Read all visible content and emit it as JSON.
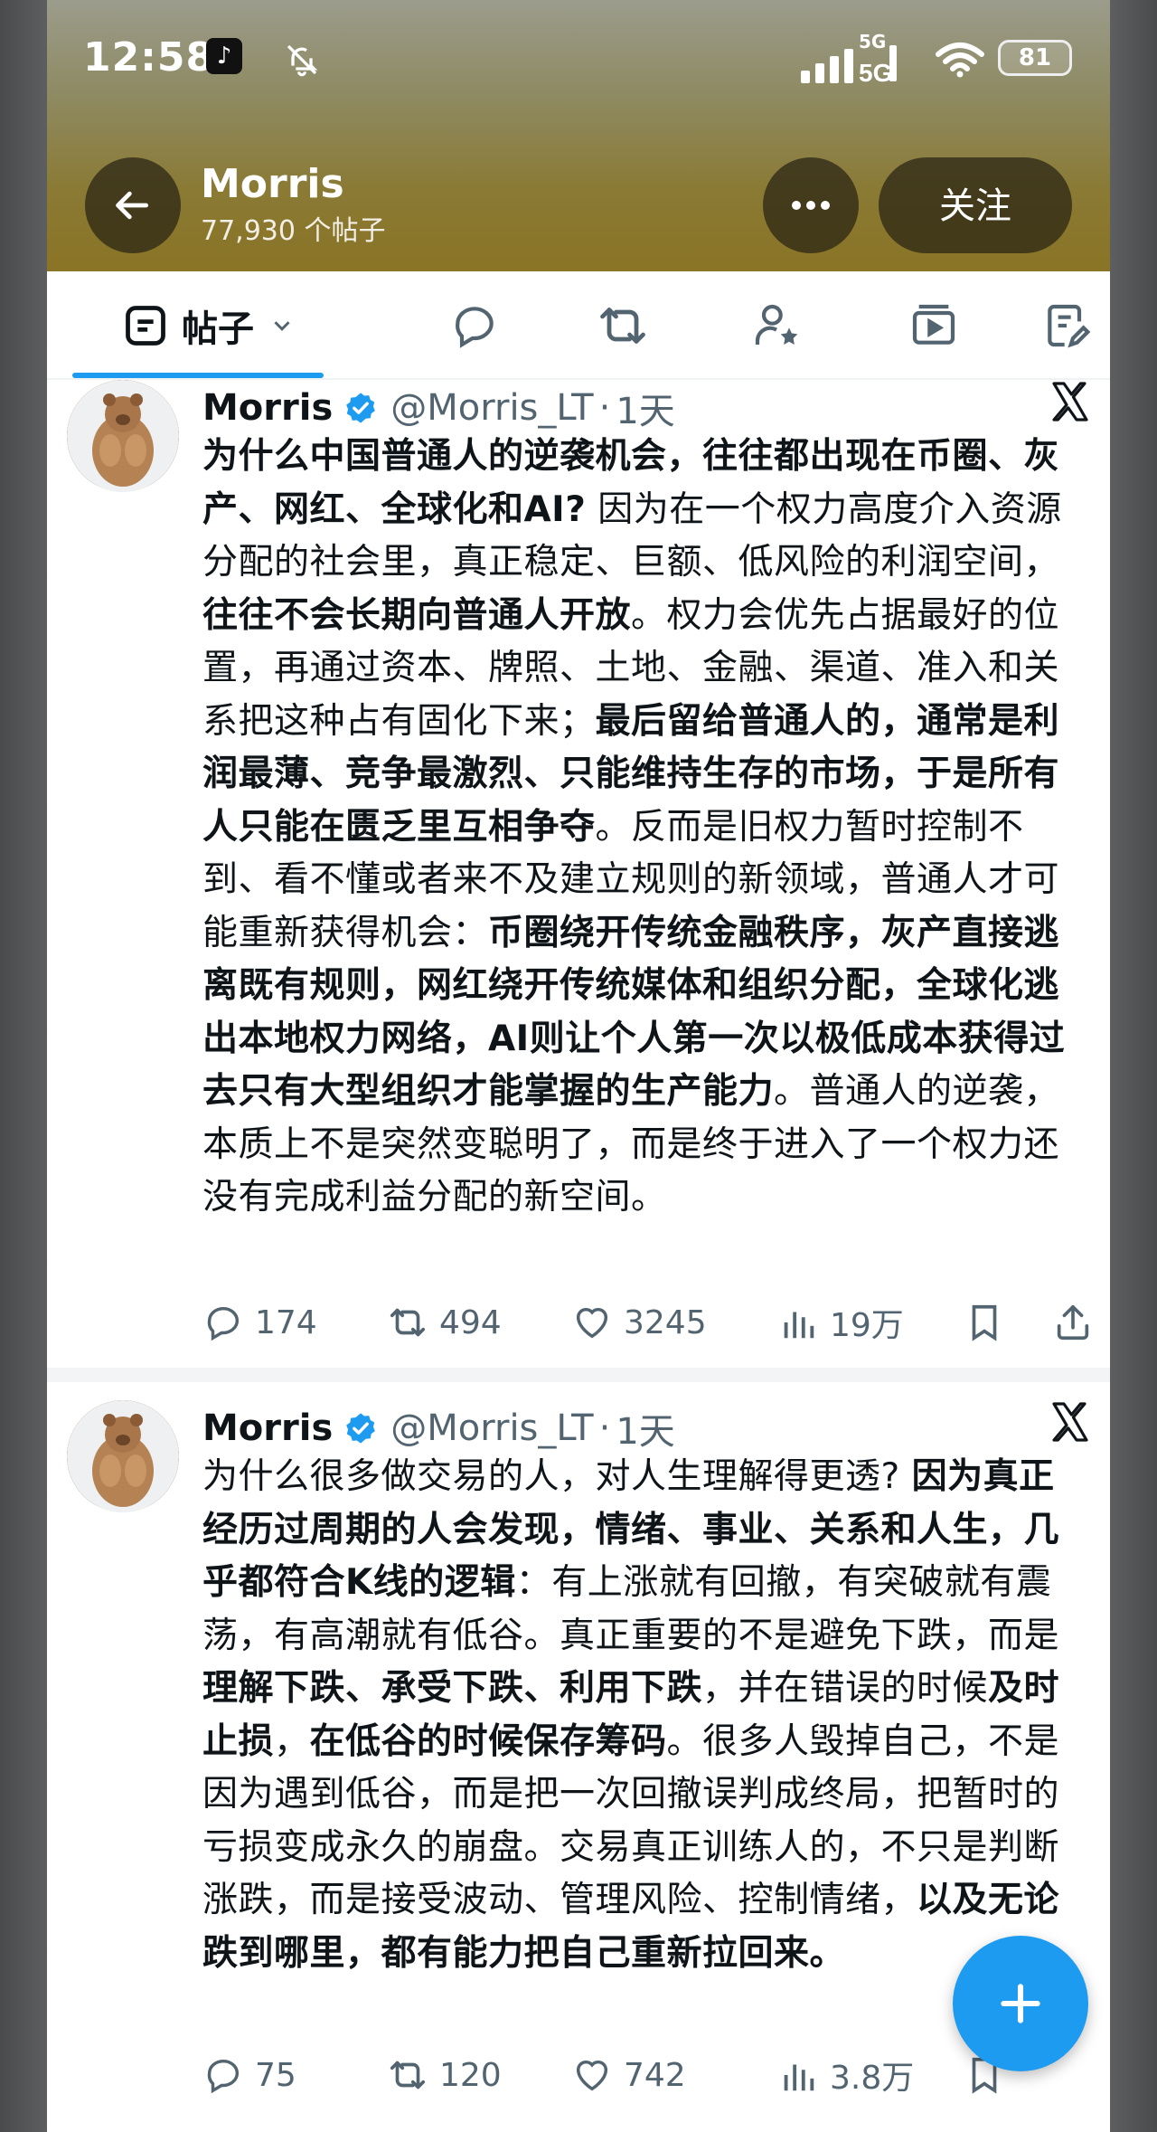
{
  "status_bar": {
    "time": "12:58",
    "network": "5G",
    "battery": "81"
  },
  "header": {
    "name": "Morris",
    "post_count": "77,930 个帖子",
    "follow_label": "关注"
  },
  "tabs": {
    "posts_label": "帖子"
  },
  "tweets": [
    {
      "name": "Morris",
      "handle": "@Morris_LT",
      "separator": "·",
      "time": "1天",
      "text_html": "<b>为什么中国普通人的逆袭机会，往往都出现在币圈、灰产、网红、全球化和AI?</b> 因为在一个权力高度介入资源分配的社会里，真正稳定、巨额、低风险的利润空间，<b>往往不会长期向普通人开放</b>。权力会优先占据最好的位置，再通过资本、牌照、土地、金融、渠道、准入和关系把这种占有固化下来；<b>最后留给普通人的，通常是利润最薄、竞争最激烈、只能维持生存的市场，于是所有人只能在匮乏里互相争夺</b>。反而是旧权力暂时控制不到、看不懂或者来不及建立规则的新领域，普通人才可能重新获得机会：<b>币圈绕开传统金融秩序，灰产直接逃离既有规则，网红绕开传统媒体和组织分配，全球化逃出本地权力网络，AI则让个人第一次以极低成本获得过去只有大型组织才能掌握的生产能力</b>。普通人的逆袭，本质上不是突然变聪明了，而是终于进入了一个权力还没有完成利益分配的新空间。",
      "replies": "174",
      "retweets": "494",
      "likes": "3245",
      "views": "19万"
    },
    {
      "name": "Morris",
      "handle": "@Morris_LT",
      "separator": "·",
      "time": "1天",
      "text_html": "为什么很多做交易的人，对人生理解得更透? <b>因为真正经历过周期的人会发现，情绪、事业、关系和人生，几乎都符合K线的逻辑</b>：有上涨就有回撤，有突破就有震荡，有高潮就有低谷。真正重要的不是避免下跌，而是<b>理解下跌、承受下跌、利用下跌</b>，并在错误的时候<b>及时止损</b>，<b>在低谷的时候保存筹码</b>。很多人毁掉自己，不是因为遇到低谷，而是把一次回撤误判成终局，把暂时的亏损变成永久的崩盘。交易真正训练人的，不只是判断涨跌，而是接受波动、管理风险、控制情绪，<b>以及无论跌到哪里，都有能力把自己重新拉回来。</b>",
      "replies": "75",
      "retweets": "120",
      "likes": "742",
      "views": "3.8万"
    }
  ],
  "icons": {
    "back": "arrow-left-icon",
    "more": "more-horizontal-icon",
    "reply": "reply-icon",
    "retweet": "retweet-icon",
    "like": "heart-icon",
    "views": "views-icon",
    "bookmark": "bookmark-icon",
    "share": "share-icon",
    "compose": "plus-icon"
  },
  "colors": {
    "accent": "#1d9bf0",
    "text": "#0f1419",
    "muted": "#536471"
  }
}
